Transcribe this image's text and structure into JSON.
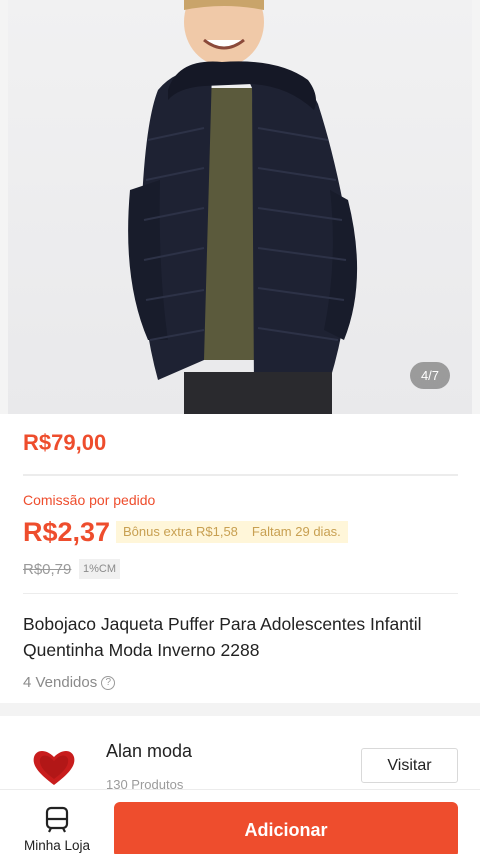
{
  "product": {
    "image_counter": "4/7",
    "price": "R$79,00",
    "commission_label": "Comissão por pedido",
    "commission_value": "R$2,37",
    "bonus_text": "Bônus extra R$1,58",
    "bonus_deadline": "Faltam 29 dias.",
    "old_commission": "R$0,79",
    "cm_tag": "1%CM",
    "title": "Bobojaco Jaqueta Puffer Para Adolescentes Infantil Quentinha Moda Inverno   2288",
    "sold": "4 Vendidos",
    "sold_info_icon": "info-icon"
  },
  "shop": {
    "name": "Alan moda",
    "subtitle": "130 Produtos",
    "visit_label": "Visitar",
    "logo_icon": "heart-logo"
  },
  "bottombar": {
    "store_label": "Minha Loja",
    "store_icon": "store-icon",
    "add_label": "Adicionar"
  },
  "colors": {
    "accent": "#ee4d2d",
    "bonus_bg": "#fff6d9",
    "bonus_text": "#c8a052"
  }
}
